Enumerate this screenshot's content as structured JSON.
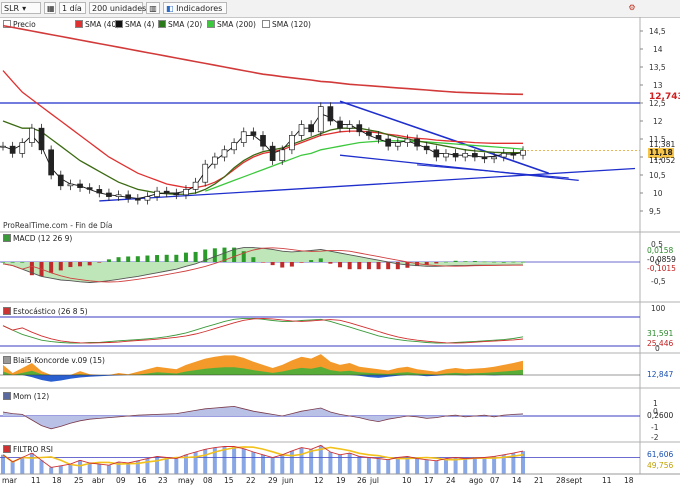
{
  "toolbar": {
    "ticker": "SLR",
    "period": "1 día",
    "units": "200 unidades",
    "indicators": "Indicadores"
  },
  "legend": [
    {
      "label": "Precio",
      "color": "#ffffff"
    },
    {
      "label": "SMA (40)",
      "color": "#e03030"
    },
    {
      "label": "SMA (4)",
      "color": "#111111"
    },
    {
      "label": "SMA (20)",
      "color": "#2a7a1a"
    },
    {
      "label": "SMA (200)",
      "color": "#3cc83c"
    },
    {
      "label": "SMA (120)",
      "color": "#ffffff"
    }
  ],
  "watermark": "ProRealTime.com - Fin de Día",
  "price_panel": {
    "y_ticks": [
      "14,5",
      "14",
      "13,5",
      "13",
      "12,5",
      "12",
      "11,5",
      "11",
      "10,5",
      "10",
      "9,5"
    ],
    "tags": [
      {
        "text": "12,743",
        "color": "#d02020",
        "bg": "#ffffff"
      },
      {
        "text": "11,381",
        "color": "#000000",
        "bg": "#ffffff"
      },
      {
        "text": "11,18",
        "color": "#000000",
        "bg": "#f7c54a"
      },
      {
        "text": "11,052",
        "color": "#000000",
        "bg": "#ffffff"
      }
    ]
  },
  "macd_panel": {
    "label": "MACD (12 26 9)",
    "color": "#3a9a3a",
    "y_ticks": [
      "0,5",
      "0",
      "-0,5"
    ],
    "tags": [
      {
        "text": "0,0158",
        "color": "#2a8a2a"
      },
      {
        "text": "-0,0859",
        "color": "#222222"
      },
      {
        "text": "-0,1015",
        "color": "#c02020"
      }
    ]
  },
  "stoch_panel": {
    "label": "Estocástico (26 8 5)",
    "color": "#cc3333",
    "y_ticks": [
      "100",
      "0"
    ],
    "tags": [
      {
        "text": "31,591",
        "color": "#2a8a2a"
      },
      {
        "text": "25,446",
        "color": "#c02020"
      }
    ]
  },
  "koncorde_panel": {
    "label": "Blai5 Koncorde v.09 (15)",
    "color": "#999999",
    "tags": [
      {
        "text": "12,847",
        "color": "#1a4fb0"
      }
    ]
  },
  "mom_panel": {
    "label": "Mom (12)",
    "color": "#5a6aa0",
    "y_ticks": [
      "1",
      "0",
      "-1",
      "-2"
    ],
    "tags": [
      {
        "text": "0,2600",
        "color": "#333333"
      }
    ]
  },
  "rsi_panel": {
    "label": "FILTRO RSI",
    "color": "#d03030",
    "tags": [
      {
        "text": "61,606",
        "color": "#1a4fb0"
      },
      {
        "text": "49,756",
        "color": "#c0a000"
      }
    ]
  },
  "x_axis": [
    "mar",
    "11",
    "18",
    "25",
    "abr",
    "09",
    "16",
    "23",
    "may",
    "08",
    "15",
    "22",
    "29",
    "jun",
    "12",
    "19",
    "26",
    "jul",
    "10",
    "17",
    "24",
    "ago",
    "07",
    "14",
    "21",
    "28",
    "sept",
    "11",
    "18"
  ],
  "chart_data": {
    "type": "line",
    "title": "",
    "series": [
      {
        "name": "Precio",
        "values": [
          11.3,
          11.1,
          11.4,
          11.8,
          11.2,
          10.5,
          10.2,
          10.25,
          10.15,
          10.1,
          10.0,
          9.9,
          9.95,
          9.85,
          9.8,
          9.9,
          10.05,
          10.0,
          9.95,
          10.1,
          10.3,
          10.8,
          11.0,
          11.2,
          11.4,
          11.7,
          11.6,
          11.3,
          10.9,
          11.2,
          11.6,
          11.9,
          11.7,
          12.4,
          12.0,
          11.8,
          11.9,
          11.7,
          11.6,
          11.5,
          11.3,
          11.4,
          11.5,
          11.3,
          11.2,
          11.0,
          11.1,
          11.0,
          11.1,
          11.0,
          10.95,
          11.0,
          11.1,
          11.05,
          11.18
        ]
      },
      {
        "name": "SMA (4)",
        "values": [
          11.3,
          11.2,
          11.35,
          11.6,
          11.3,
          10.7,
          10.4,
          10.25,
          10.2,
          10.1,
          10.0,
          9.95,
          9.92,
          9.88,
          9.85,
          9.9,
          9.98,
          10.0,
          10.0,
          10.05,
          10.2,
          10.6,
          10.9,
          11.1,
          11.3,
          11.6,
          11.6,
          11.4,
          11.1,
          11.2,
          11.5,
          11.8,
          11.8,
          12.2,
          12.1,
          11.9,
          11.9,
          11.75,
          11.6,
          11.5,
          11.4,
          11.4,
          11.45,
          11.35,
          11.25,
          11.1,
          11.1,
          11.05,
          11.05,
          11.02,
          11.0,
          11.02,
          11.08,
          11.08,
          11.12
        ]
      },
      {
        "name": "SMA (20)",
        "values": [
          12.0,
          11.9,
          11.8,
          11.8,
          11.7,
          11.5,
          11.3,
          11.1,
          10.9,
          10.75,
          10.6,
          10.45,
          10.3,
          10.2,
          10.1,
          10.05,
          10.0,
          9.98,
          9.96,
          9.97,
          10.0,
          10.1,
          10.25,
          10.45,
          10.7,
          10.9,
          11.05,
          11.15,
          11.2,
          11.25,
          11.35,
          11.45,
          11.55,
          11.65,
          11.75,
          11.8,
          11.8,
          11.8,
          11.75,
          11.7,
          11.62,
          11.55,
          11.5,
          11.45,
          11.4,
          11.35,
          11.3,
          11.25,
          11.2,
          11.17,
          11.15,
          11.13,
          11.12,
          11.12,
          11.12
        ]
      },
      {
        "name": "SMA (40)",
        "values": [
          13.4,
          13.1,
          12.8,
          12.6,
          12.4,
          12.2,
          12.0,
          11.8,
          11.6,
          11.4,
          11.2,
          11.0,
          10.85,
          10.7,
          10.55,
          10.45,
          10.35,
          10.25,
          10.2,
          10.15,
          10.15,
          10.2,
          10.3,
          10.45,
          10.65,
          10.85,
          11.0,
          11.1,
          11.15,
          11.2,
          11.3,
          11.4,
          11.5,
          11.6,
          11.65,
          11.7,
          11.72,
          11.72,
          11.7,
          11.67,
          11.63,
          11.6,
          11.55,
          11.52,
          11.5,
          11.47,
          11.45,
          11.43,
          11.42,
          11.4,
          11.39,
          11.38,
          11.38,
          11.38,
          11.38
        ]
      },
      {
        "name": "SMA (200)",
        "values": [
          null,
          null,
          null,
          null,
          null,
          null,
          null,
          null,
          null,
          null,
          null,
          null,
          null,
          null,
          null,
          null,
          null,
          null,
          null,
          null,
          null,
          10.05,
          10.15,
          10.25,
          10.35,
          10.45,
          10.55,
          10.65,
          10.75,
          10.85,
          10.95,
          11.05,
          11.1,
          11.2,
          11.25,
          11.3,
          11.35,
          11.4,
          11.42,
          11.44,
          11.45,
          11.45,
          11.44,
          11.43,
          11.42,
          11.4,
          11.38,
          11.36,
          11.34,
          11.32,
          11.3,
          11.28,
          11.26,
          11.24,
          11.22
        ]
      },
      {
        "name": "SMA (120)",
        "values": [
          14.65,
          14.6,
          14.55,
          14.5,
          14.45,
          14.4,
          14.35,
          14.3,
          14.25,
          14.2,
          14.15,
          14.1,
          14.05,
          14.0,
          13.95,
          13.9,
          13.85,
          13.8,
          13.75,
          13.7,
          13.65,
          13.6,
          13.55,
          13.5,
          13.45,
          13.4,
          13.35,
          13.3,
          13.27,
          13.23,
          13.2,
          13.17,
          13.14,
          13.1,
          13.08,
          13.05,
          13.02,
          13.0,
          12.98,
          12.96,
          12.94,
          12.92,
          12.9,
          12.88,
          12.86,
          12.84,
          12.82,
          12.8,
          12.79,
          12.78,
          12.77,
          12.76,
          12.75,
          12.745,
          12.743
        ]
      }
    ],
    "macd": [
      -0.05,
      -0.1,
      -0.2,
      -0.3,
      -0.4,
      -0.45,
      -0.5,
      -0.52,
      -0.55,
      -0.57,
      -0.55,
      -0.52,
      -0.48,
      -0.44,
      -0.4,
      -0.35,
      -0.3,
      -0.25,
      -0.2,
      -0.12,
      -0.05,
      0.05,
      0.15,
      0.25,
      0.35,
      0.4,
      0.4,
      0.38,
      0.35,
      0.3,
      0.28,
      0.3,
      0.32,
      0.35,
      0.3,
      0.25,
      0.2,
      0.15,
      0.1,
      0.05,
      0.0,
      -0.05,
      -0.08,
      -0.1,
      -0.12,
      -0.12,
      -0.11,
      -0.1,
      -0.1,
      -0.09,
      -0.09,
      -0.09,
      -0.09,
      -0.086,
      -0.086
    ],
    "stoch": [
      70,
      55,
      40,
      30,
      20,
      15,
      12,
      10,
      10,
      12,
      12,
      15,
      18,
      20,
      22,
      25,
      28,
      32,
      38,
      45,
      55,
      65,
      75,
      85,
      92,
      95,
      95,
      92,
      88,
      85,
      85,
      88,
      90,
      92,
      85,
      75,
      65,
      55,
      45,
      35,
      28,
      22,
      18,
      15,
      12,
      10,
      10,
      12,
      14,
      16,
      18,
      20,
      22,
      26,
      31.591
    ],
    "mom": [
      0.5,
      0.3,
      0.2,
      -0.5,
      -1.2,
      -1.6,
      -1.3,
      -0.9,
      -0.6,
      -0.4,
      -0.3,
      -0.2,
      -0.1,
      0.0,
      0.1,
      0.15,
      0.2,
      0.25,
      0.3,
      0.5,
      0.7,
      0.9,
      1.0,
      1.1,
      1.2,
      0.9,
      0.6,
      0.4,
      0.2,
      0.0,
      0.3,
      0.6,
      0.8,
      1.0,
      0.5,
      0.2,
      0.0,
      -0.2,
      -0.5,
      -0.7,
      -0.4,
      -0.2,
      0.0,
      -0.1,
      -0.3,
      -0.2,
      0.0,
      0.1,
      -0.1,
      0.0,
      0.1,
      -0.1,
      0.1,
      0.2,
      0.26
    ],
    "rsi": [
      55,
      42,
      50,
      58,
      45,
      32,
      35,
      38,
      45,
      40,
      38,
      36,
      42,
      40,
      44,
      48,
      52,
      50,
      48,
      55,
      60,
      65,
      68,
      70,
      70,
      66,
      60,
      55,
      50,
      55,
      62,
      68,
      65,
      72,
      60,
      55,
      58,
      52,
      50,
      48,
      46,
      50,
      52,
      48,
      46,
      44,
      48,
      50,
      48,
      49,
      50,
      52,
      55,
      58,
      61.6
    ]
  }
}
